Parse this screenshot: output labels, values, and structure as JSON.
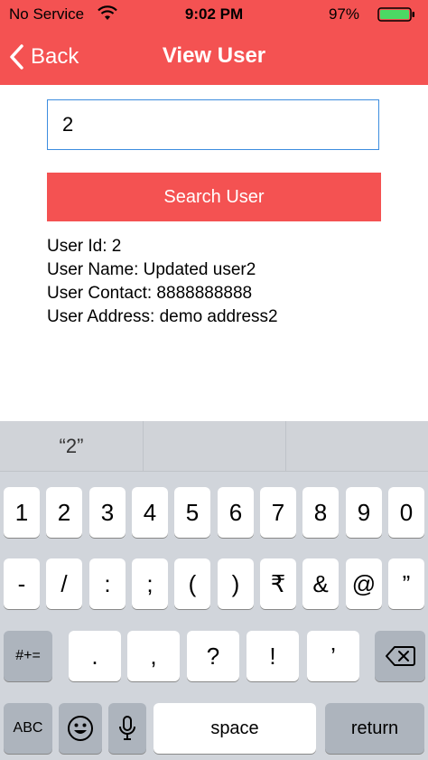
{
  "status": {
    "carrier": "No Service",
    "time": "9:02 PM",
    "battery": "97%"
  },
  "nav": {
    "back": "Back",
    "title": "View User"
  },
  "search": {
    "value": "2",
    "button": "Search User"
  },
  "user": {
    "id": "User Id: 2",
    "name": "User Name: Updated user2",
    "contact": "User Contact: 8888888888",
    "address": "User Address: demo address2"
  },
  "keyboard": {
    "suggestions": [
      "“2”",
      "",
      ""
    ],
    "row1": [
      "1",
      "2",
      "3",
      "4",
      "5",
      "6",
      "7",
      "8",
      "9",
      "0"
    ],
    "row2": [
      "-",
      "/",
      ":",
      ";",
      "(",
      ")",
      "₹",
      "&",
      "@",
      "”"
    ],
    "row3": [
      "#+=",
      ".",
      ",",
      "?",
      "!",
      "’"
    ],
    "abc": "ABC",
    "space": "space",
    "return": "return"
  },
  "colors": {
    "accent": "#f45252",
    "input_border": "#3d8ddf"
  }
}
